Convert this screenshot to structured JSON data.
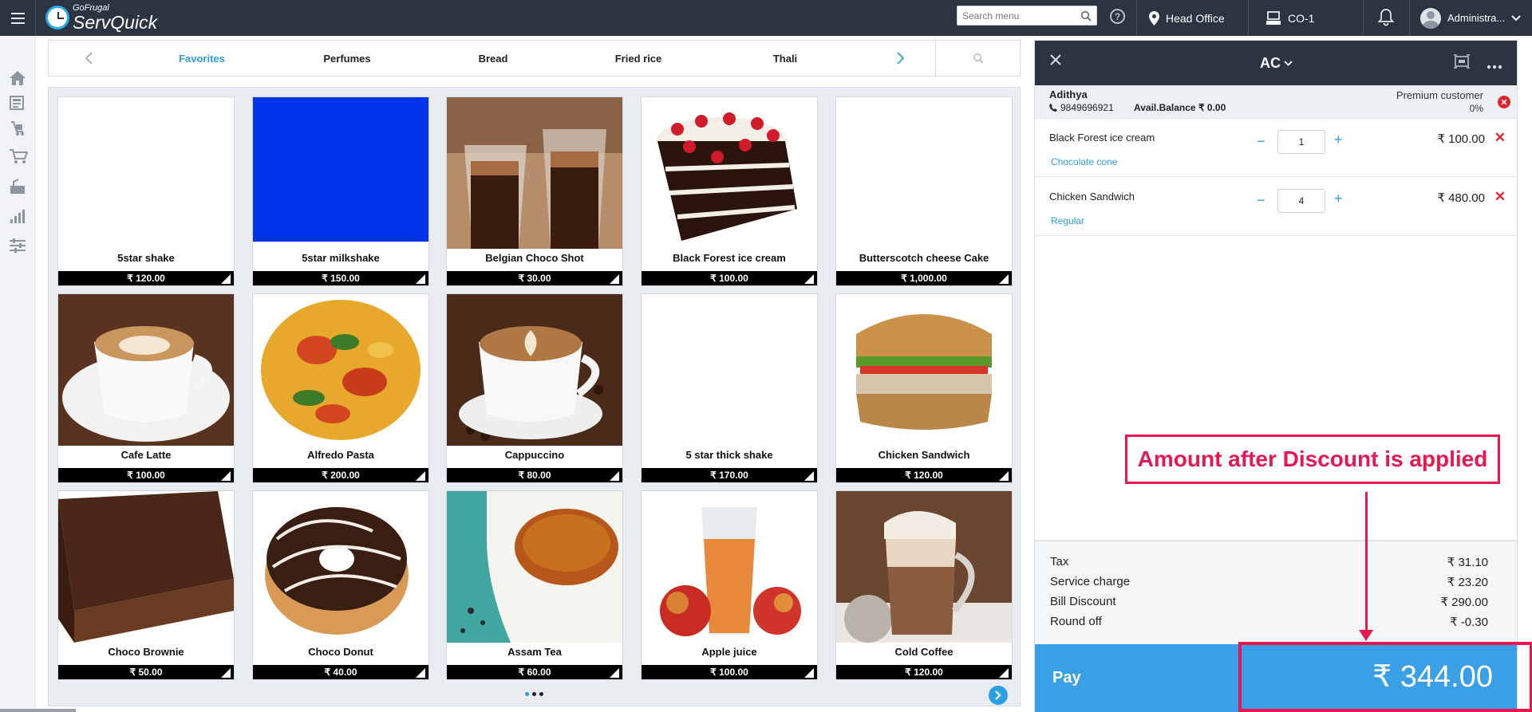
{
  "app": {
    "brand_small": "GoFrugal",
    "brand_name": "ServQuick"
  },
  "topbar": {
    "search_placeholder": "Search menu",
    "location": "Head Office",
    "counter": "CO-1",
    "user": "Administra..."
  },
  "sidebar": {
    "items": [
      {
        "icon": "home-icon"
      },
      {
        "icon": "orders-icon"
      },
      {
        "icon": "delivery-icon"
      },
      {
        "icon": "cart-icon"
      },
      {
        "icon": "kitchen-icon"
      },
      {
        "icon": "reports-icon"
      },
      {
        "icon": "settings-sliders-icon"
      }
    ]
  },
  "categories": {
    "tabs": [
      {
        "label": "Favorites",
        "active": true
      },
      {
        "label": "Perfumes"
      },
      {
        "label": "Bread"
      },
      {
        "label": "Fried rice"
      },
      {
        "label": "Thali"
      }
    ]
  },
  "products": [
    {
      "name": "5star shake",
      "price": "₹ 120.00",
      "image": "blank"
    },
    {
      "name": "5star milkshake",
      "price": "₹ 150.00",
      "image": "blue"
    },
    {
      "name": "Belgian Choco Shot",
      "price": "₹ 30.00",
      "image": "choco-shot"
    },
    {
      "name": "Black Forest ice cream",
      "price": "₹ 100.00",
      "image": "black-forest-cake"
    },
    {
      "name": "Butterscotch cheese Cake",
      "price": "₹ 1,000.00",
      "image": "blank"
    },
    {
      "name": "Cafe Latte",
      "price": "₹ 100.00",
      "image": "latte"
    },
    {
      "name": "Alfredo Pasta",
      "price": "₹ 200.00",
      "image": "pasta"
    },
    {
      "name": "Cappuccino",
      "price": "₹ 80.00",
      "image": "cappuccino"
    },
    {
      "name": "5 star thick shake",
      "price": "₹ 170.00",
      "image": "blank"
    },
    {
      "name": "Chicken Sandwich",
      "price": "₹ 120.00",
      "image": "sandwich"
    },
    {
      "name": "Choco Brownie",
      "price": "₹ 50.00",
      "image": "brownie"
    },
    {
      "name": "Choco Donut",
      "price": "₹ 40.00",
      "image": "donut"
    },
    {
      "name": "Assam Tea",
      "price": "₹ 60.00",
      "image": "tea"
    },
    {
      "name": "Apple juice",
      "price": "₹ 100.00",
      "image": "apple-juice"
    },
    {
      "name": "Cold Coffee",
      "price": "₹ 120.00",
      "image": "cold-coffee"
    }
  ],
  "order": {
    "type": "AC",
    "customer": {
      "name": "Adithya",
      "phone": "9849696921",
      "balance": "Avail.Balance ₹ 0.00",
      "category": "Premium customer",
      "discount_pct": "0%"
    },
    "lines": [
      {
        "name": "Black Forest ice cream",
        "modifier": "Chocolate cone",
        "qty": "1",
        "price": "₹ 100.00"
      },
      {
        "name": "Chicken Sandwich",
        "modifier": "Regular",
        "qty": "4",
        "price": "₹ 480.00"
      }
    ],
    "totals": [
      {
        "label": "Tax",
        "value": "₹ 31.10"
      },
      {
        "label": "Service charge",
        "value": "₹ 23.20"
      },
      {
        "label": "Bill Discount",
        "value": "₹ 290.00"
      },
      {
        "label": "Round off",
        "value": "₹ -0.30"
      }
    ],
    "pay_label": "Pay",
    "pay_amount": "₹ 344.00"
  },
  "annotation": {
    "text": "Amount after Discount is applied",
    "color": "#e8174f"
  },
  "colors": {
    "accent": "#2d9ee0",
    "topbar": "#2b3440",
    "pay": "#39a0e6",
    "danger": "#e3202e"
  },
  "pager": {
    "pages": 3,
    "current": 1
  }
}
